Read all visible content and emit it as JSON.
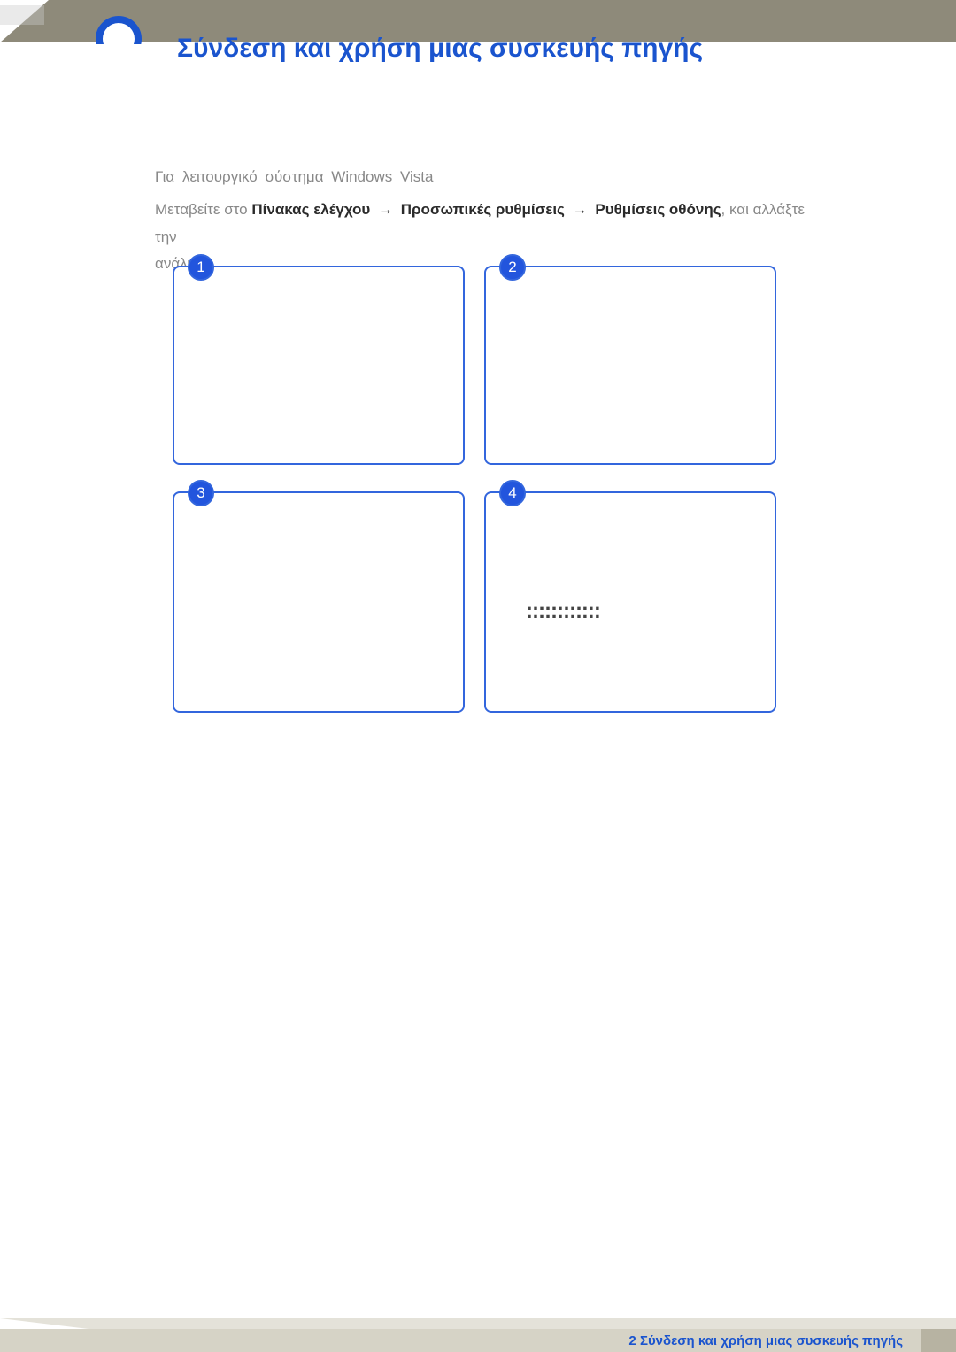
{
  "header": {
    "title": "Σύνδεση και χρήση μιας συσκευής πηγής"
  },
  "content": {
    "line1_prefix": "Για λειτουργικό σύστημα",
    "line1_os": "Windows Vista",
    "line2_prefix": "Μεταβείτε στο",
    "path1": "Πίνακας ελέγχου",
    "arrow": "→",
    "path2": "Προσωπικές ρυθμίσεις",
    "path3": "Ρυθμίσεις οθόνης",
    "line2_suffix1": ", και αλλάξτε την",
    "line2_suffix2": "ανάλυση."
  },
  "boxes": {
    "b1": "1",
    "b2": "2",
    "b3": "3",
    "b4": "4",
    "placeholder": "::::::::::::"
  },
  "footer": {
    "chapter": "2",
    "text": "Σύνδεση και χρήση μιας συσκευής πηγής"
  }
}
